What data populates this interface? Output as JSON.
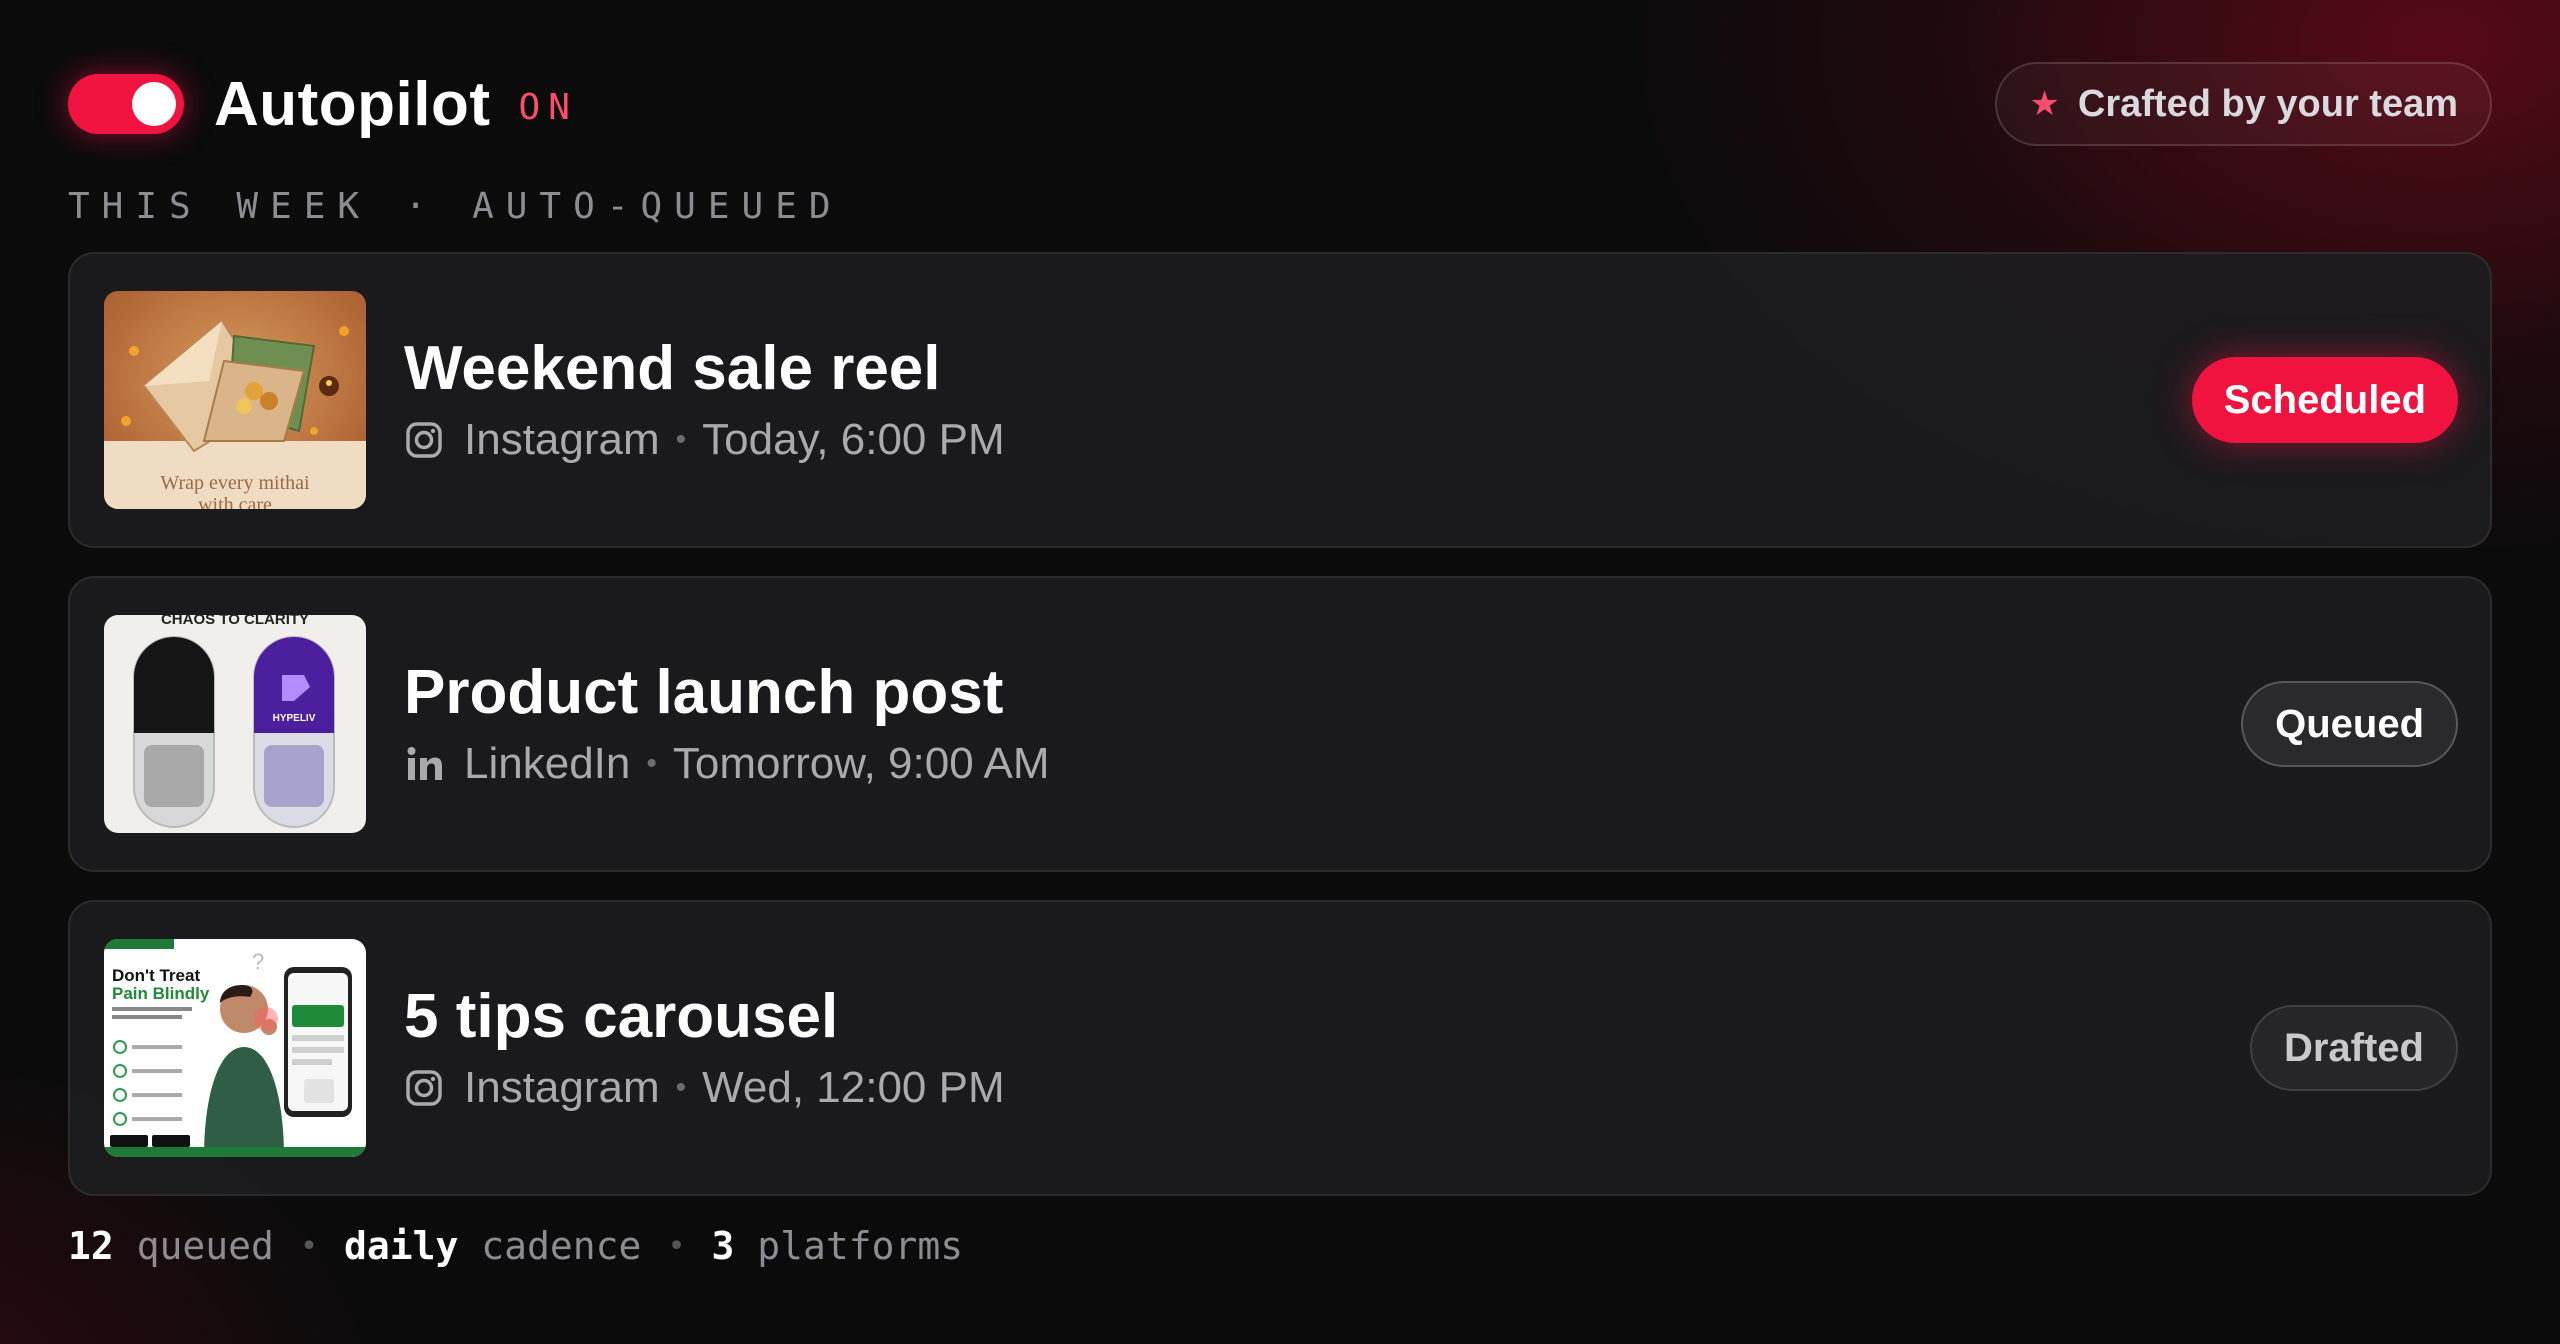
{
  "header": {
    "title": "Autopilot",
    "status": "ON",
    "badge": "Crafted by your team",
    "badge_icon": "star-icon",
    "toggle_on": true,
    "accent_color": "#f0133f"
  },
  "section_label": "THIS WEEK · AUTO-QUEUED",
  "posts": [
    {
      "title": "Weekend sale reel",
      "platform": "Instagram",
      "platform_icon": "instagram-icon",
      "time": "Today, 6:00 PM",
      "status": "Scheduled",
      "thumbnail_text": "Wrap every mithai with care"
    },
    {
      "title": "Product launch post",
      "platform": "LinkedIn",
      "platform_icon": "linkedin-icon",
      "time": "Tomorrow, 9:00 AM",
      "status": "Queued",
      "thumbnail_text": "CHAOS TO CLARITY",
      "thumbnail_brand": "HYPELIV"
    },
    {
      "title": "5 tips carousel",
      "platform": "Instagram",
      "platform_icon": "instagram-icon",
      "time": "Wed, 12:00 PM",
      "status": "Drafted",
      "thumbnail_text": "Don't Treat Pain Blindly"
    }
  ],
  "footer": {
    "queued_count": "12",
    "queued_label": "queued",
    "cadence_value": "daily",
    "cadence_label": "cadence",
    "platforms_count": "3",
    "platforms_label": "platforms"
  }
}
